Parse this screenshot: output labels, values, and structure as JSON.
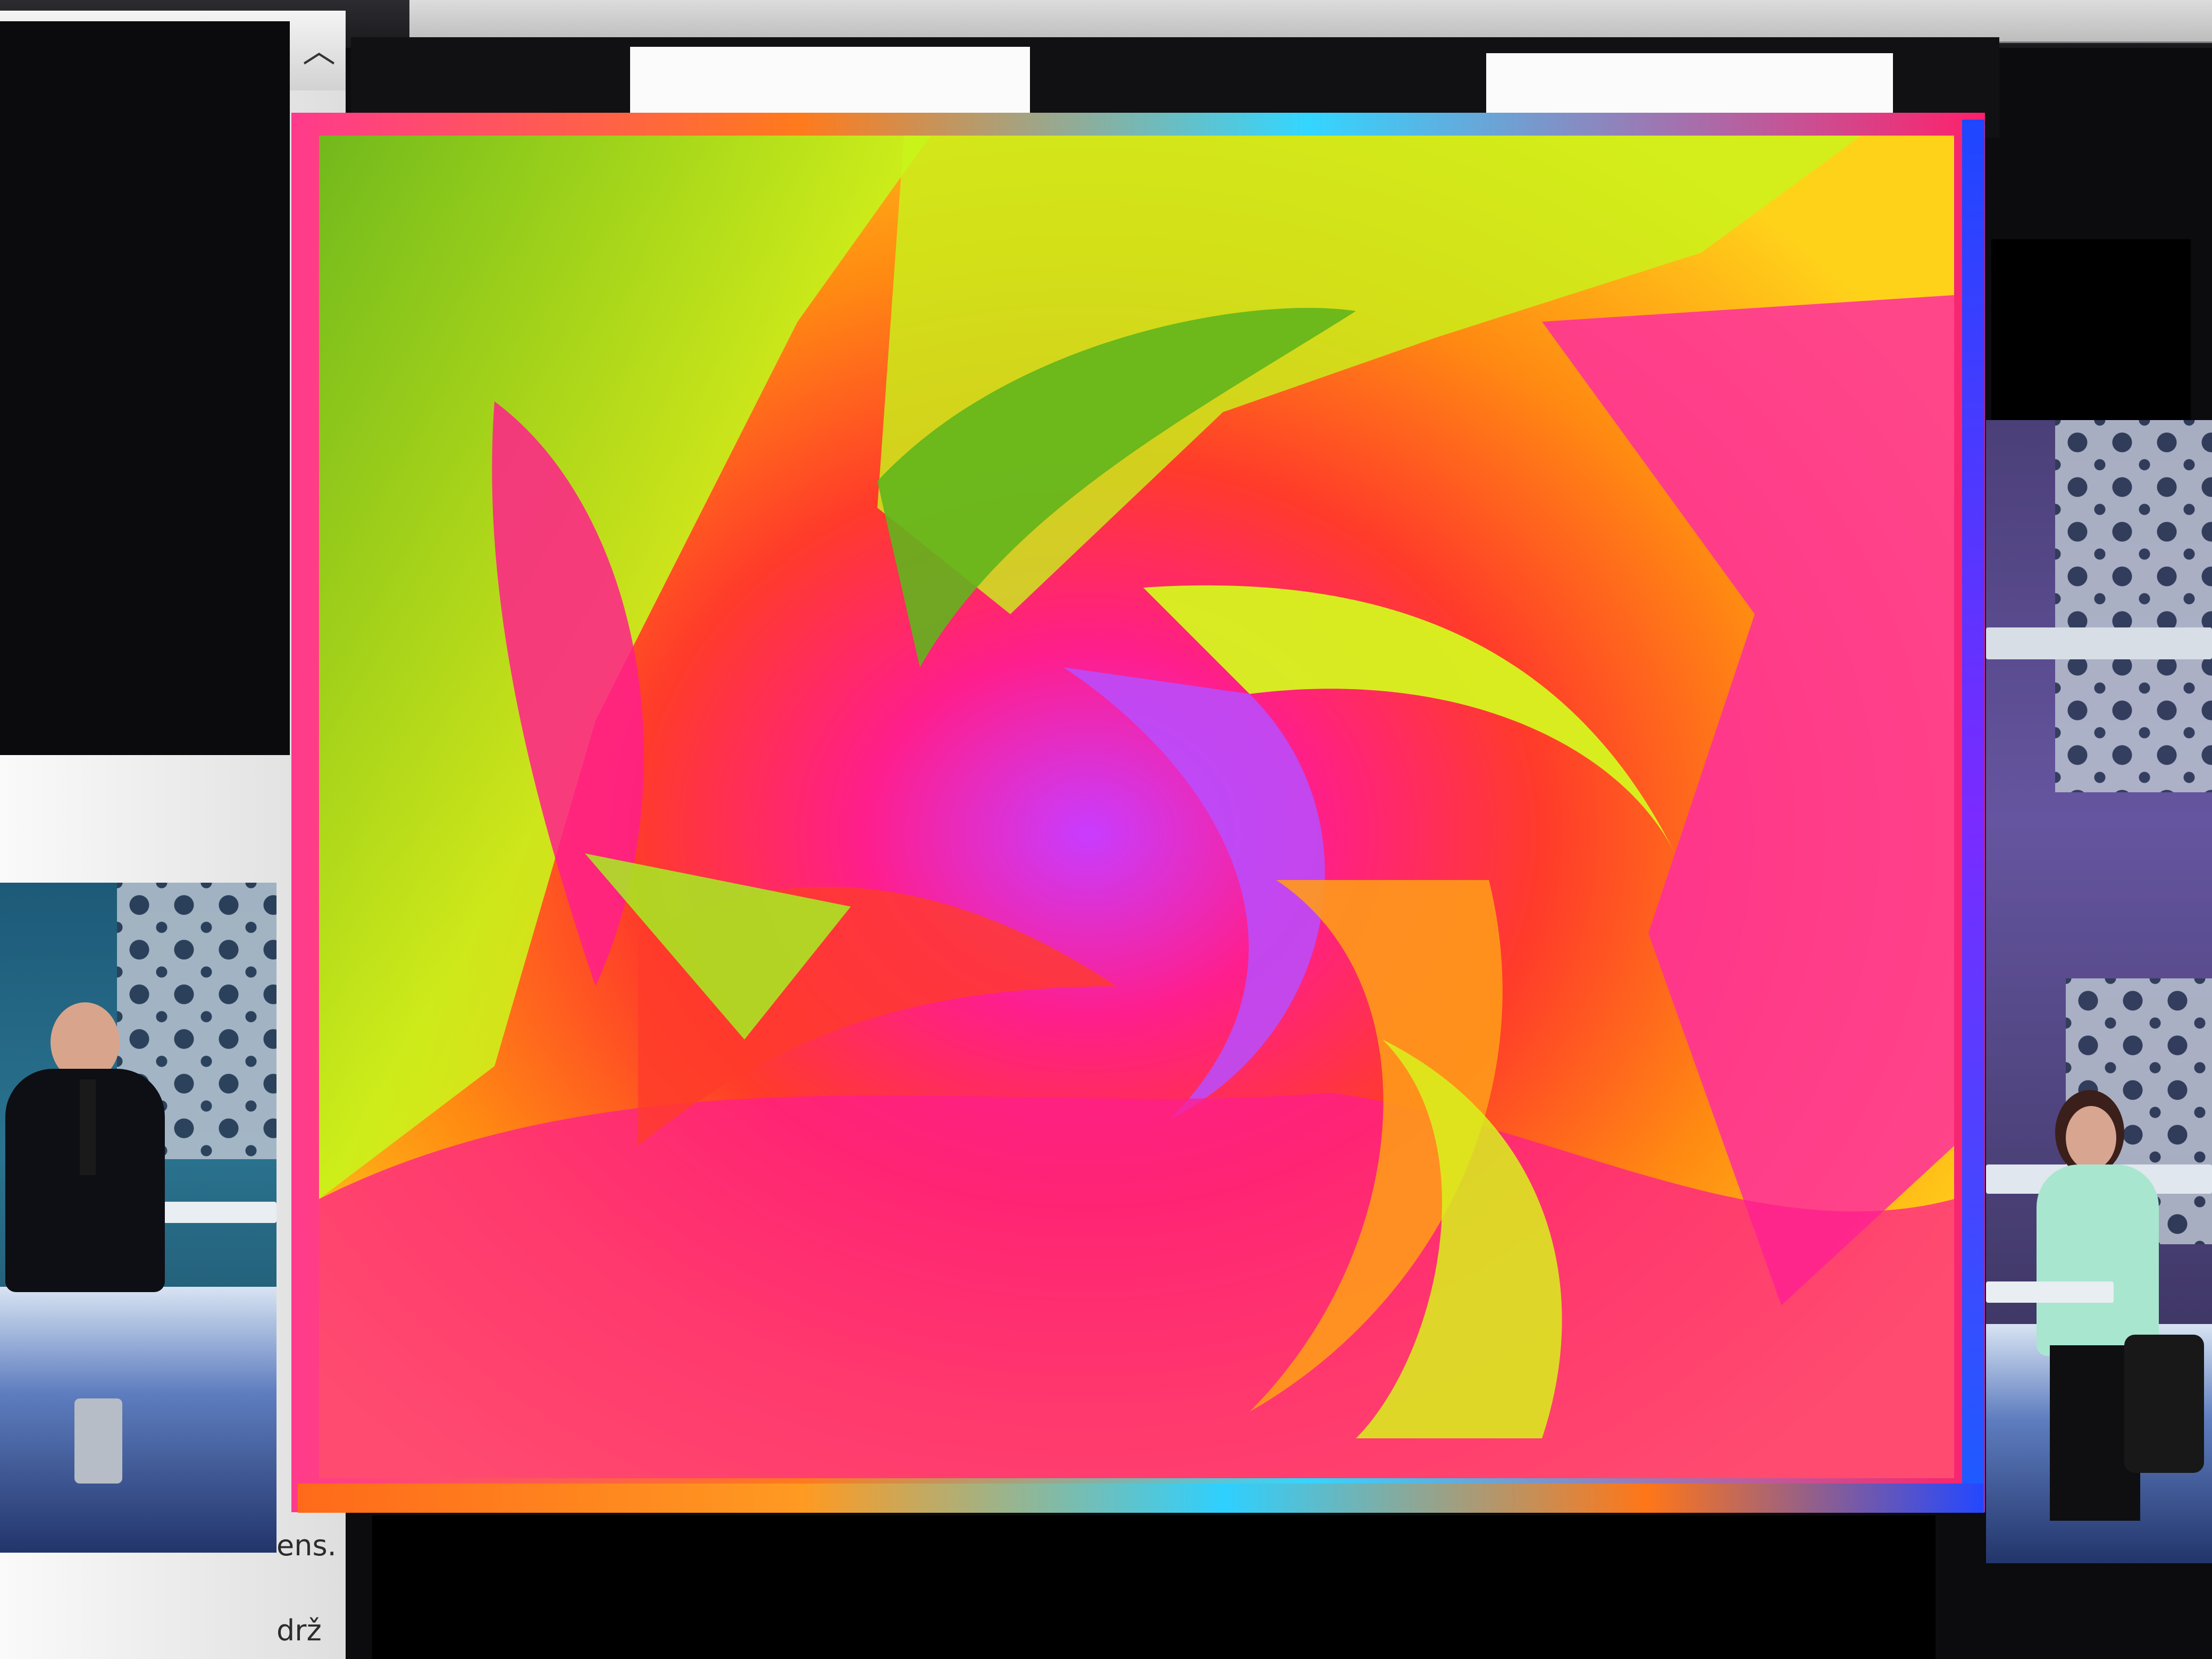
{
  "window": {
    "scroll_up_glyph": "︿",
    "partial_text_line_1": "ens.",
    "partial_text_line_2": "drž"
  },
  "artwork": {
    "palette": [
      "#ff1e8c",
      "#ff3b2a",
      "#ff8a12",
      "#ffd21a",
      "#c8f51a",
      "#62b51c",
      "#c93cff",
      "#8d3bff"
    ]
  },
  "icons": {
    "scroll_up": "chevron-up-icon"
  }
}
